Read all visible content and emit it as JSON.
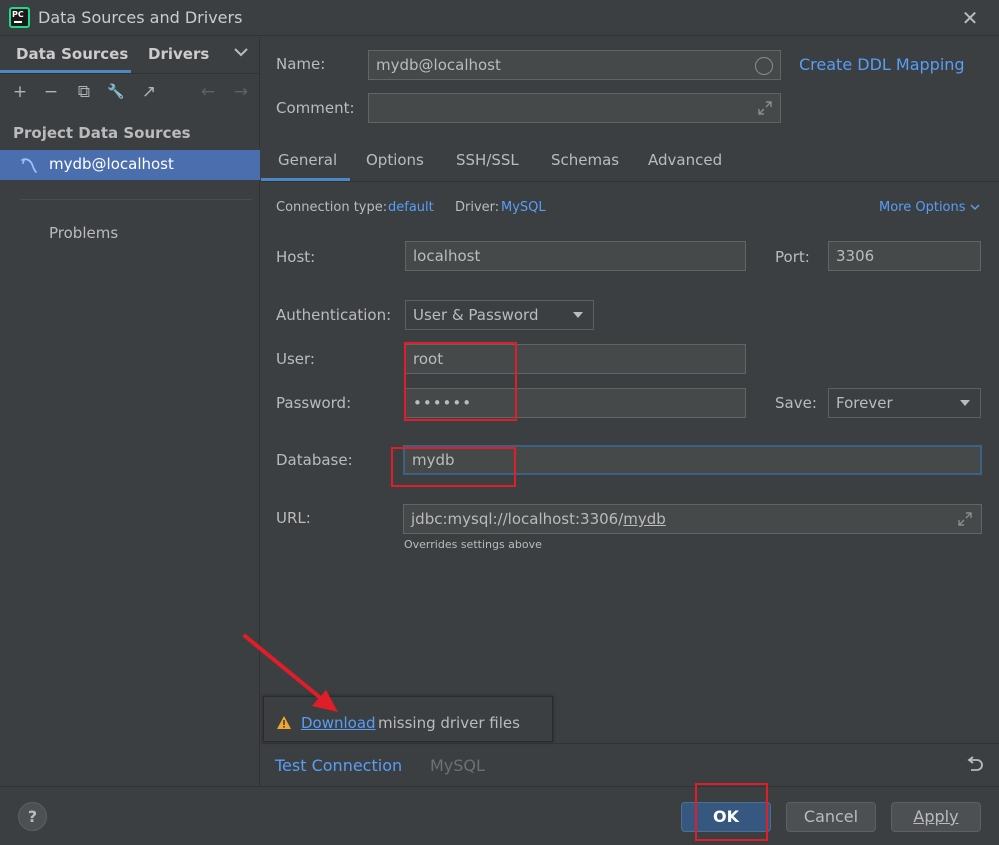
{
  "window": {
    "title": "Data Sources and Drivers",
    "close_glyph": "✕"
  },
  "left": {
    "tabs": [
      "Data Sources",
      "Drivers"
    ],
    "toolbar": [
      "+",
      "−",
      "⧉",
      "🔧",
      "↗",
      "←",
      "→"
    ],
    "section_title": "Project Data Sources",
    "selected_item": "mydb@localhost",
    "problems": "Problems"
  },
  "form": {
    "name_label": "Name:",
    "name_value": "mydb@localhost",
    "ddl_link": "Create DDL Mapping",
    "comment_label": "Comment:",
    "comment_value": "",
    "tabs": [
      "General",
      "Options",
      "SSH/SSL",
      "Schemas",
      "Advanced"
    ],
    "connection_type_label": "Connection type:",
    "connection_type_value": "default",
    "driver_label": "Driver:",
    "driver_value": "MySQL",
    "more_options": "More Options",
    "host_label": "Host:",
    "host_value": "localhost",
    "port_label": "Port:",
    "port_value": "3306",
    "auth_label": "Authentication:",
    "auth_value": "User & Password",
    "user_label": "User:",
    "user_value": "root",
    "password_label": "Password:",
    "password_value": "••••••",
    "save_label": "Save:",
    "save_value": "Forever",
    "database_label": "Database:",
    "database_value": "mydb",
    "url_label": "URL:",
    "url_prefix": "jdbc:mysql://localhost:3306/",
    "url_db": "mydb",
    "url_hint": "Overrides settings above"
  },
  "notice": {
    "link": "Download",
    "text": " missing driver files"
  },
  "bottom": {
    "test_connection": "Test Connection",
    "driver_name": "MySQL"
  },
  "buttons": {
    "help": "?",
    "ok": "OK",
    "cancel": "Cancel",
    "apply": "Apply"
  },
  "colors": {
    "accent": "#4a88c7",
    "link": "#589df6",
    "selection": "#4b6eaf",
    "annotation_red": "#e01e2a"
  }
}
